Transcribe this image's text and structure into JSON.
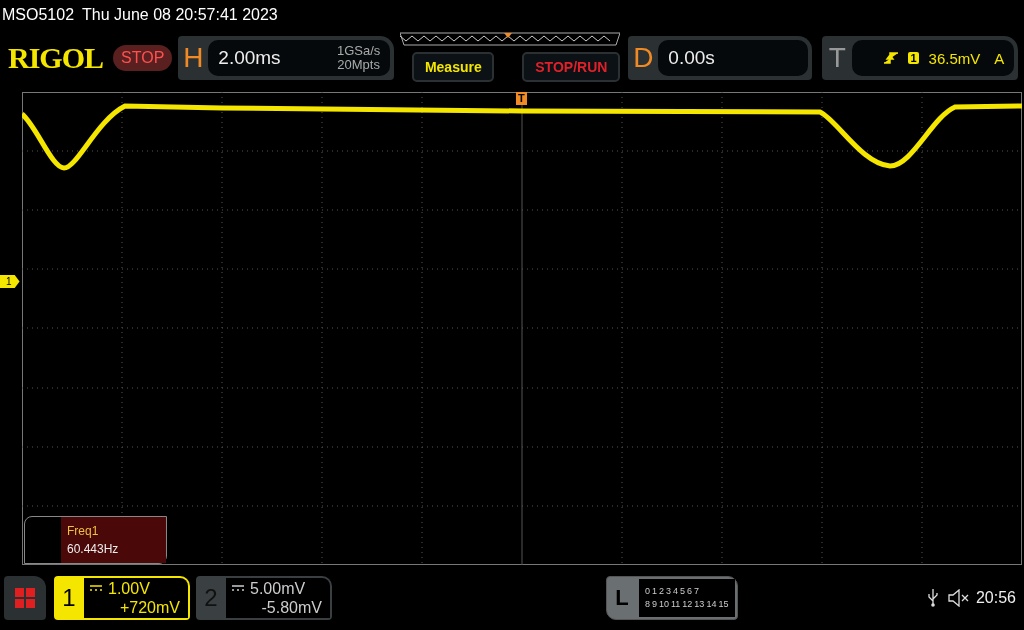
{
  "title_bar": {
    "model": "MSO5102",
    "datetime": "Thu June 08 20:57:41 2023"
  },
  "logo": "RIGOL",
  "run_state": {
    "label": "STOP",
    "kind": "stop"
  },
  "horizontal": {
    "letter": "H",
    "timebase": "2.00ms",
    "sample_rate": "1GSa/s",
    "memory_depth": "20Mpts"
  },
  "buttons": [
    {
      "label": "Measure",
      "kind": "measure"
    },
    {
      "label": "STOP/RUN",
      "kind": "stoprun"
    }
  ],
  "delay": {
    "letter": "D",
    "value": "0.00s"
  },
  "trigger": {
    "letter": "T",
    "source": "1",
    "level": "36.5mV",
    "mode": "A"
  },
  "trigger_marker": "T",
  "channel_marker": "1",
  "measurement": {
    "name": "Freq1",
    "value": "60.443Hz"
  },
  "channels": [
    {
      "number": "1",
      "scale": "1.00V",
      "offset": "+720mV",
      "selected": true
    },
    {
      "number": "2",
      "scale": "5.00mV",
      "offset": "-5.80mV",
      "selected": false
    }
  ],
  "logic": {
    "letter": "L",
    "row_1": [
      "0",
      "1",
      "2",
      "3",
      "4",
      "5",
      "6",
      "7"
    ],
    "row_2": [
      "8",
      "9",
      "10",
      "11",
      "12",
      "13",
      "14",
      "15"
    ]
  },
  "status": {
    "time": "20:56"
  }
}
